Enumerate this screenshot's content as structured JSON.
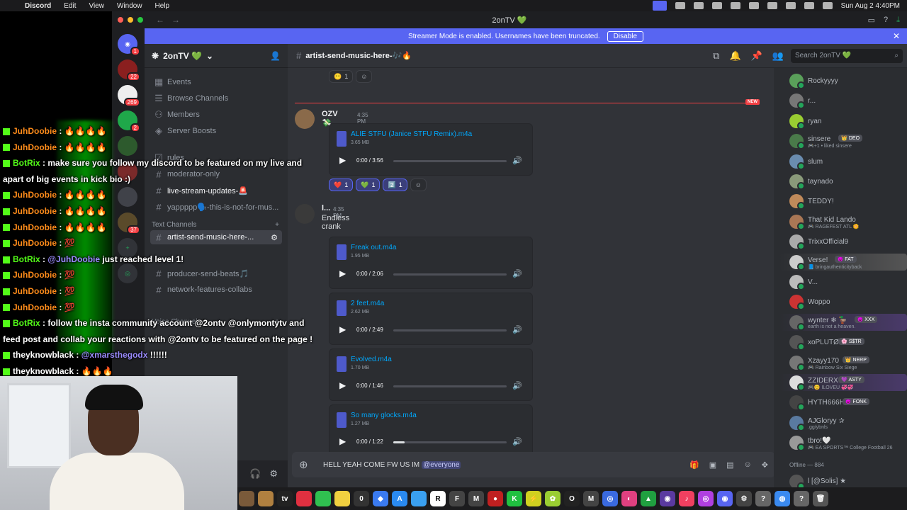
{
  "menubar": {
    "app_name": "Discord",
    "items": [
      "Edit",
      "View",
      "Window",
      "Help"
    ],
    "clock": "Sun Aug 2  4:40PM"
  },
  "window": {
    "title": "2onTV 💚",
    "streamer_banner": "Streamer Mode is enabled. Usernames have been truncated.",
    "disable_label": "Disable"
  },
  "rail": {
    "badges": [
      "1",
      "22",
      "269",
      "2",
      "37"
    ]
  },
  "sidebar": {
    "guild_name": "2onTV 💚",
    "top_items": [
      "Events",
      "Browse Channels",
      "Members",
      "Server Boosts"
    ],
    "channels": [
      "rules",
      "moderator-only",
      "live-stream-updates-🚨",
      "yappppp🗣️-this-is-not-for-mus..."
    ],
    "text_category": "Text Channels",
    "text_channels": [
      "artist-send-music-here-...",
      "producer-send-beats🎵",
      "network-features-collabs"
    ],
    "voice_category": "Voice Channels"
  },
  "chat": {
    "channel_title": "artist-send-music-here-🎶🔥",
    "search_placeholder": "Search 2onTV 💚",
    "new_label": "NEW",
    "top_reaction_count": "1",
    "messages": [
      {
        "author": "OZV 💸",
        "time": "4:35 PM",
        "attachments": [
          {
            "name": "ALIE STFU (Janice STFU Remix).m4a",
            "size": "3.65 MB",
            "time": "0:00 / 3:56"
          }
        ],
        "reactions": [
          {
            "emoji": "❤️",
            "count": "1"
          },
          {
            "emoji": "💚",
            "count": "1"
          },
          {
            "emoji": "2️⃣",
            "count": "1"
          }
        ]
      },
      {
        "author": "l...",
        "time": "4:35 PM",
        "text": "Endless crank",
        "attachments": [
          {
            "name": "Freak out.m4a",
            "size": "1.95 MB",
            "time": "0:00 / 2:06"
          },
          {
            "name": "2 feet.m4a",
            "size": "2.62 MB",
            "time": "0:00 / 2:49"
          },
          {
            "name": "Evolved.m4a",
            "size": "1.70 MB",
            "time": "0:00 / 1:46"
          },
          {
            "name": "So many glocks.m4a",
            "size": "1.27 MB",
            "time": "0:00 / 1:22"
          }
        ]
      }
    ],
    "progress_fraction": [
      0.0,
      0.0,
      0.0,
      0.0,
      0.1
    ],
    "composer_text": "HELL YEAH COME FW US IM",
    "composer_mention": "@everyone"
  },
  "members": {
    "online": [
      {
        "name": "Rockyyyy",
        "color": "#5aa05a"
      },
      {
        "name": "r...",
        "color": "#777777"
      },
      {
        "name": "ryan",
        "color": "#9acd32"
      },
      {
        "name": "sinsere",
        "tag": "👑 DEO",
        "sub": "🎮+1 • liked sinsere",
        "color": "#4a7a4a"
      },
      {
        "name": "slum",
        "color": "#6a8caf"
      },
      {
        "name": "taynado",
        "color": "#8a9a7a"
      },
      {
        "name": "TEDDY!",
        "color": "#c08a5a"
      },
      {
        "name": "That Kid Lando",
        "sub": "🎮 RAGEFEST ATL 🌼",
        "color": "#aa7755"
      },
      {
        "name": "TrixxOfficial9",
        "color": "#aaaaaa"
      },
      {
        "name": "Verse!",
        "tag": "😈 FAT",
        "sub": "📘 bringauthenticityback",
        "color": "#cccccc"
      },
      {
        "name": "V...",
        "color": "#bbbbbb"
      },
      {
        "name": "Woppo",
        "color": "#cc3333"
      },
      {
        "name": "wynter ❄ 🦆",
        "tag": "😈 XXX",
        "sub": "earth is not a heaven.",
        "color": "#666666"
      },
      {
        "name": "xoPLUTØ",
        "tag": "🌸 S$TR",
        "color": "#555555"
      },
      {
        "name": "Xzayy170",
        "tag": "👑 NERP",
        "sub": "🎮 Rainbow Six Siege",
        "color": "#777777"
      },
      {
        "name": "ZZIDERX",
        "tag": "💜 ASTY",
        "sub": "🎮😊 ILOVEU 💞💞",
        "color": "#dddddd"
      },
      {
        "name": "ᕼYTᕼ666ᕼ",
        "tag": "😈 FONK",
        "color": "#444444"
      },
      {
        "name": "AJGloryy ✰",
        "sub": ".gg/ybnls",
        "color": "#5a7aa0"
      },
      {
        "name": "tbro!🤍",
        "sub": "🎮 EA SPORTS™ College Football 26",
        "color": "#999999"
      }
    ],
    "offline_label": "Offline — 884",
    "offline_first": "l [@Solis] ★"
  },
  "overlay_chat": [
    {
      "user": "JuhDoobie",
      "msg": "🔥🔥🔥🔥"
    },
    {
      "user": "JuhDoobie",
      "msg": "🔥🔥🔥🔥"
    },
    {
      "user": "BotRix",
      "msg": "make sure you follow my discord to be featured on my live and",
      "bot": true
    },
    {
      "user": "",
      "msg": "apart of big events in kick bio :)"
    },
    {
      "user": "JuhDoobie",
      "msg": "🔥🔥🔥🔥"
    },
    {
      "user": "JuhDoobie",
      "msg": "🔥🔥🔥🔥"
    },
    {
      "user": "JuhDoobie",
      "msg": "🔥🔥🔥🔥"
    },
    {
      "user": "JuhDoobie",
      "msg": "💯"
    },
    {
      "user": "BotRix",
      "mention": "@JuhDoobie",
      "msg": "just reached level 1!",
      "bot": true
    },
    {
      "user": "JuhDoobie",
      "msg": "💯"
    },
    {
      "user": "JuhDoobie",
      "msg": "💯"
    },
    {
      "user": "JuhDoobie",
      "msg": "💯"
    },
    {
      "user": "BotRix",
      "msg": "follow the insta community account @2ontv @onlymontytv and",
      "bot": true
    },
    {
      "user": "",
      "msg": "feed post and collab your reactions with @2ontv to be featured on the page !"
    },
    {
      "user": "theyknowblack",
      "mention": "@xmarsthegodx",
      "msg": "!!!!!!",
      "white": true
    },
    {
      "user": "theyknowblack",
      "msg": "🔥🔥🔥",
      "white": true
    }
  ]
}
